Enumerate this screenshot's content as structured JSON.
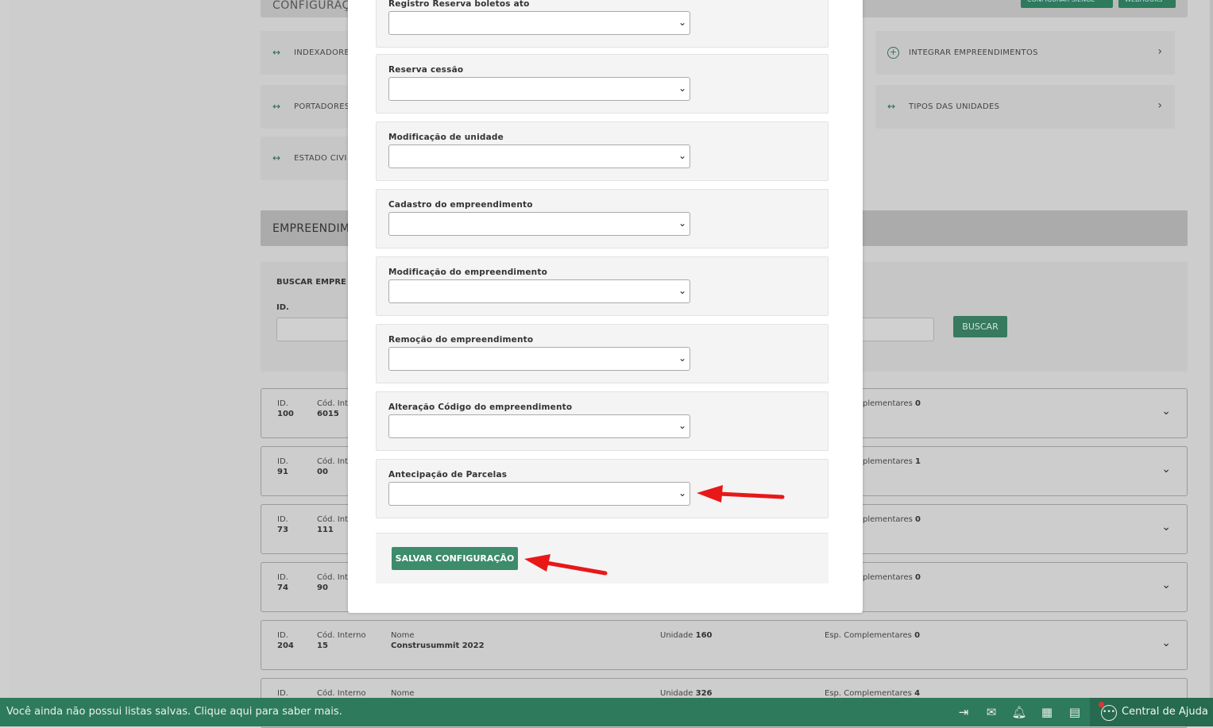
{
  "background": {
    "config_header": {
      "title": "CONFIGURAÇ",
      "btn1_label": "CONFIGURAR SIENGE",
      "btn2_label": "WEBHOOKS"
    },
    "tiles": [
      {
        "label": "INDEXADORE",
        "icon": "arrows-horizontal-icon"
      },
      {
        "label": "PORTADORES",
        "icon": "arrows-horizontal-icon"
      },
      {
        "label": "ESTADO CIVI",
        "icon": "arrows-horizontal-icon"
      },
      {
        "label": "INTEGRAR EMPREENDIMENTOS",
        "icon": "circle-plus-icon"
      },
      {
        "label": "TIPOS DAS UNIDADES",
        "icon": "arrows-horizontal-icon"
      }
    ],
    "empreendimentos_header": "EMPREENDIM",
    "search": {
      "title": "BUSCAR EMPRE",
      "id_label": "ID.",
      "button_label": "BUSCAR"
    },
    "labels": {
      "id": "ID.",
      "cod": "Cód. Int",
      "cod_full": "Cód. Interno",
      "nome": "Nome",
      "unidade": "Unidade",
      "esp_partial": "plementares",
      "esp_full": "Esp. Complementares"
    },
    "rows": [
      {
        "id": "100",
        "cod": "6015",
        "esp": "0"
      },
      {
        "id": "91",
        "cod": "00",
        "esp": "1"
      },
      {
        "id": "73",
        "cod": "111",
        "esp": "0"
      },
      {
        "id": "74",
        "cod": "90",
        "esp": "0"
      },
      {
        "id": "204",
        "cod": "15",
        "nome": "Construsummit 2022",
        "unidade": "160",
        "esp": "0"
      },
      {
        "id": "",
        "cod": "",
        "nome": "",
        "unidade": "326",
        "esp": "4"
      }
    ]
  },
  "modal": {
    "fields": [
      {
        "label": "Registro Reserva boletos ato",
        "value": ""
      },
      {
        "label": "Reserva cessão",
        "value": ""
      },
      {
        "label": "Modificação de unidade",
        "value": ""
      },
      {
        "label": "Cadastro do empreendimento",
        "value": ""
      },
      {
        "label": "Modificação do empreendimento",
        "value": ""
      },
      {
        "label": "Remoção do empreendimento",
        "value": ""
      },
      {
        "label": "Alteração Código do empreendimento",
        "value": ""
      },
      {
        "label": "Antecipação de Parcelas",
        "value": ""
      }
    ],
    "save_label": "SALVAR CONFIGURAÇÃO"
  },
  "bottom_bar": {
    "message": "Você ainda não possui listas salvas. Clique aqui para saber mais.",
    "icons": [
      "collapse-arrow-icon",
      "mail-star-icon",
      "bell-icon",
      "calendar-icon",
      "calculator-icon"
    ],
    "help_label": "Central de Ajuda"
  },
  "colors": {
    "accent_green": "#3d8c6b",
    "bottom_bar": "#2e7a5c",
    "annotation_arrow": "#e81818"
  }
}
